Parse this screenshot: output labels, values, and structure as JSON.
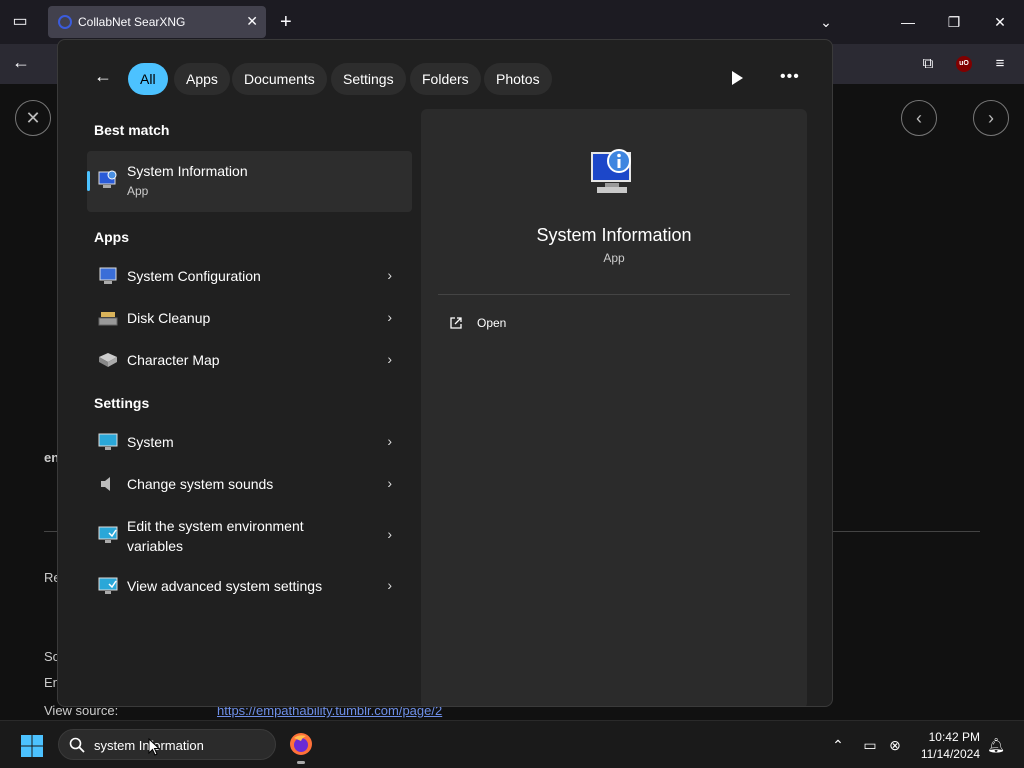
{
  "browser": {
    "tab_title": "CollabNet SearXNG",
    "tab_close": "✕",
    "new_tab": "+"
  },
  "page_fragments": {
    "frag1": "en",
    "frag2": "Re",
    "frag3": "So",
    "frag4": "En",
    "view_source_label": "View source:",
    "view_source_link": "https://empathability.tumblr.com/page/2"
  },
  "search_panel": {
    "filters": [
      "All",
      "Apps",
      "Documents",
      "Settings",
      "Folders",
      "Photos"
    ],
    "active_filter": "All",
    "best_match_heading": "Best match",
    "best_match": {
      "label": "System Information",
      "sub": "App"
    },
    "apps_heading": "Apps",
    "apps": [
      {
        "label": "System Configuration"
      },
      {
        "label": "Disk Cleanup"
      },
      {
        "label": "Character Map"
      }
    ],
    "settings_heading": "Settings",
    "settings": [
      {
        "label": "System"
      },
      {
        "label": "Change system sounds"
      },
      {
        "label_line1": "Edit the system environment",
        "label_line2": "variables"
      },
      {
        "label": "View advanced system settings"
      }
    ],
    "preview": {
      "title": "System Information",
      "sub": "App",
      "open_label": "Open"
    }
  },
  "taskbar": {
    "search_value": "system Information",
    "time": "10:42 PM",
    "date": "11/14/2024"
  },
  "colors": {
    "accent": "#4cc2ff",
    "panel_bg": "#202020",
    "preview_bg": "#2b2b2b"
  }
}
